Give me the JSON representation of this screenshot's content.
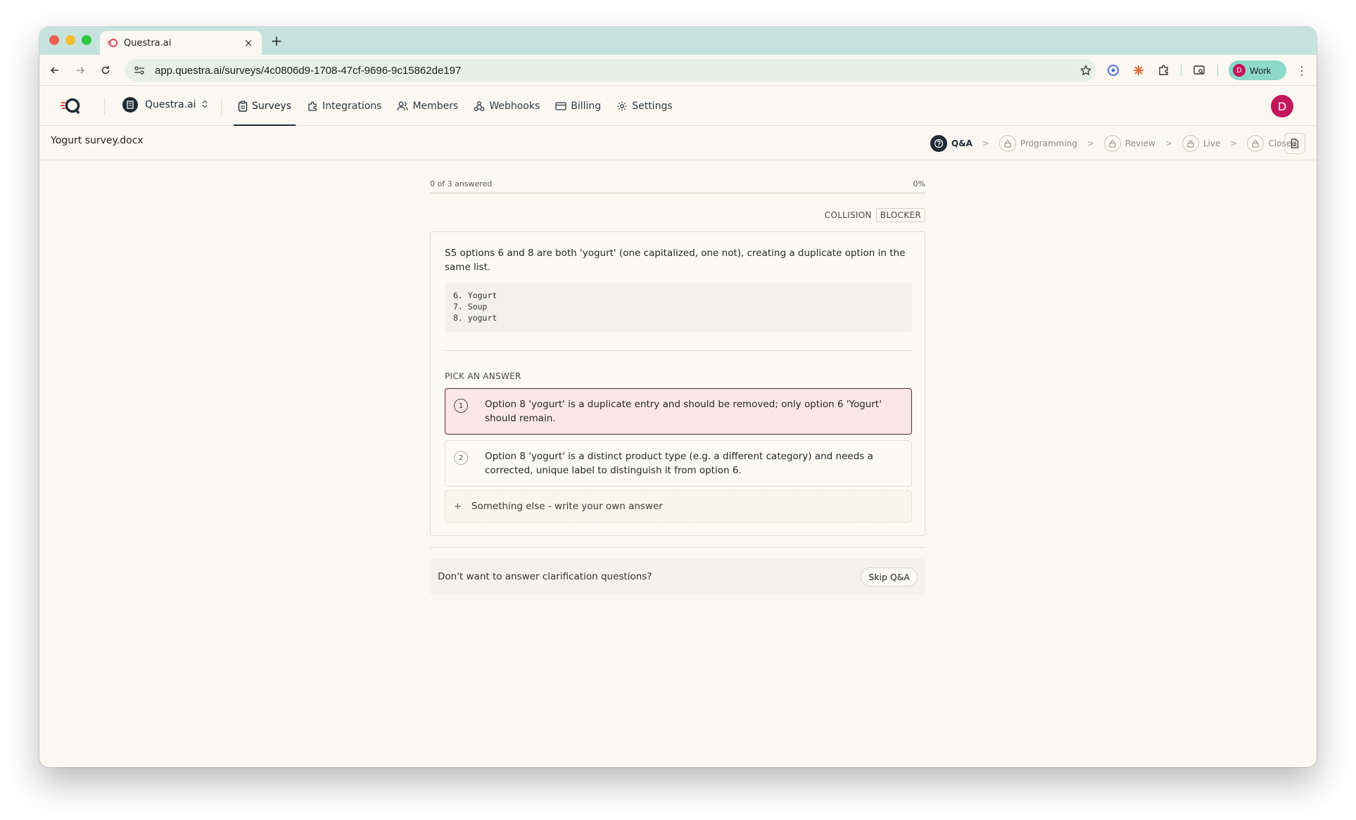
{
  "browser": {
    "tab_title": "Questra.ai",
    "url": "app.questra.ai/surveys/4c0806d9-1708-47cf-9696-9c15862de197",
    "profile_initial": "D",
    "profile_label": "Work",
    "new_tab_symbol": "+",
    "tab_close_symbol": "×",
    "menu_symbol": "⋮"
  },
  "appbar": {
    "org_name": "Questra.ai",
    "nav": [
      {
        "label": "Surveys",
        "icon": "clipboard-icon",
        "active": true
      },
      {
        "label": "Integrations",
        "icon": "puzzle-icon"
      },
      {
        "label": "Members",
        "icon": "users-icon"
      },
      {
        "label": "Webhooks",
        "icon": "webhook-icon"
      },
      {
        "label": "Billing",
        "icon": "credit-card-icon"
      },
      {
        "label": "Settings",
        "icon": "gear-icon"
      }
    ],
    "user_initial": "D"
  },
  "subbar": {
    "filename": "Yogurt survey.docx",
    "steps": [
      {
        "label": "Q&A",
        "state": "active",
        "icon": "question-icon"
      },
      {
        "label": "Programming",
        "state": "locked",
        "icon": "lock-icon"
      },
      {
        "label": "Review",
        "state": "locked",
        "icon": "lock-icon"
      },
      {
        "label": "Live",
        "state": "locked",
        "icon": "lock-icon"
      },
      {
        "label": "Closed",
        "state": "locked",
        "icon": "lock-icon"
      }
    ]
  },
  "progress": {
    "answered_text": "0 of 3 answered",
    "percent_text": "0%",
    "fraction": 0
  },
  "question": {
    "tag_type": "COLLISION",
    "tag_severity": "BLOCKER",
    "text": "S5 options 6 and 8 are both 'yogurt' (one capitalized, one not), creating a duplicate option in the same list.",
    "code_lines": [
      "6. Yogurt",
      "7. Soup",
      "8. yogurt"
    ],
    "pick_label": "PICK AN ANSWER",
    "options": [
      {
        "number": "1",
        "text": "Option 8 'yogurt' is a duplicate entry and should be removed; only option 6 'Yogurt' should remain.",
        "selected": true
      },
      {
        "number": "2",
        "text": "Option 8 'yogurt' is a distinct product type (e.g. a different category) and needs a corrected, unique label to distinguish it from option 6.",
        "selected": false
      }
    ],
    "custom_symbol": "+",
    "custom_label": "Something else - write your own answer"
  },
  "skip": {
    "prompt": "Don't want to answer clarification questions?",
    "button_label": "Skip Q&A"
  },
  "colors": {
    "tabstrip": "#c6e2dc",
    "page_bg": "#faf8f0",
    "accent_dark": "#1f2a36",
    "avatar": "#c2185b",
    "selected_option_bg": "#fce7e8"
  }
}
